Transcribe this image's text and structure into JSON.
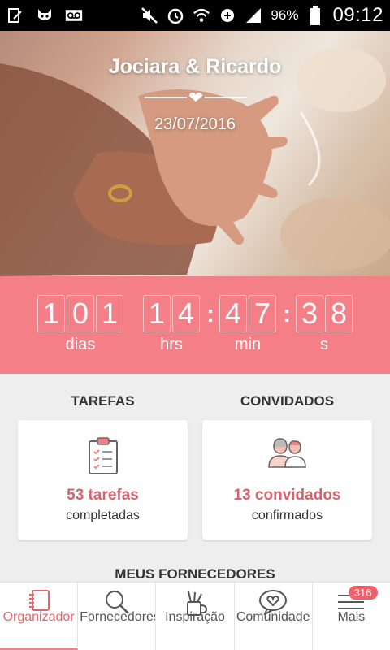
{
  "status_bar": {
    "battery_percent": "96%",
    "time": "09:12"
  },
  "hero": {
    "couple_names": "Jociara & Ricardo",
    "wedding_date": "23/07/2016"
  },
  "countdown": {
    "days": [
      "1",
      "0",
      "1"
    ],
    "hours": [
      "1",
      "4"
    ],
    "minutes": [
      "4",
      "7"
    ],
    "seconds": [
      "3",
      "8"
    ],
    "separator": ":",
    "labels": {
      "days": "dias",
      "hours": "hrs",
      "minutes": "min",
      "seconds": "s"
    }
  },
  "tasks": {
    "title": "TAREFAS",
    "count": "53 tarefas",
    "subtitle": "completadas"
  },
  "guests": {
    "title": "CONVIDADOS",
    "count": "13 convidados",
    "subtitle": "confirmados"
  },
  "suppliers": {
    "title": "MEUS FORNECEDORES"
  },
  "bottom_nav": {
    "items": [
      {
        "label": "Organizador",
        "icon": "notebook-icon",
        "active": true
      },
      {
        "label": "Fornecedores",
        "icon": "search-icon",
        "active": false
      },
      {
        "label": "Inspiração",
        "icon": "brushes-icon",
        "active": false
      },
      {
        "label": "Comunidade",
        "icon": "heart-chat-icon",
        "active": false
      },
      {
        "label": "Mais",
        "icon": "menu-icon",
        "active": false,
        "badge": "316"
      }
    ]
  },
  "colors": {
    "accent": "#f47f86",
    "accent_text": "#d9626c"
  }
}
